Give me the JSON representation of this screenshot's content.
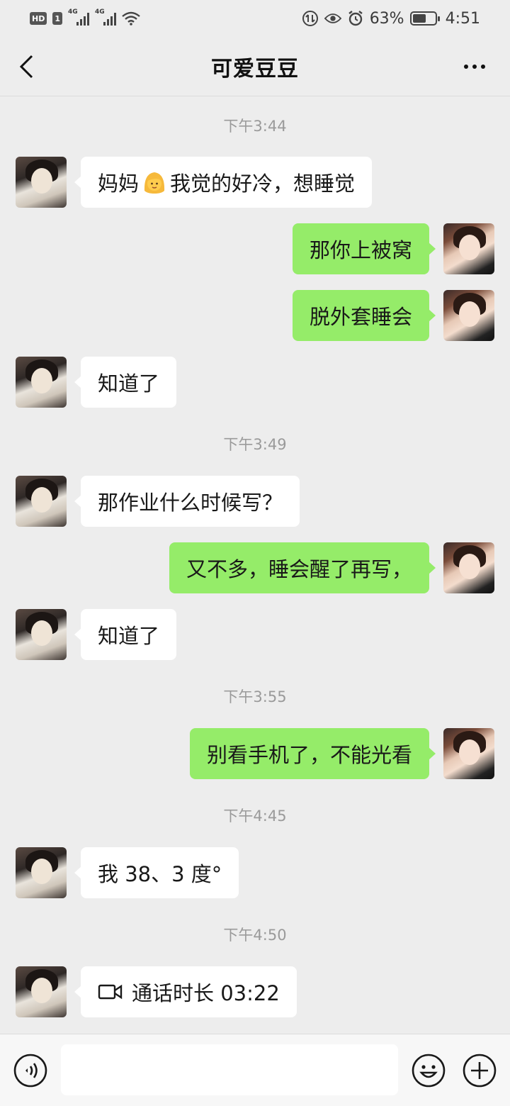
{
  "status_bar": {
    "left_badge_hd": "HD",
    "left_badge_sim": "1",
    "network_1": "4G",
    "network_2": "4G",
    "battery_percent": "63%",
    "battery_level": 0.63,
    "time": "4:51"
  },
  "header": {
    "title": "可爱豆豆"
  },
  "messages": [
    {
      "type": "time",
      "text": "下午3:44"
    },
    {
      "type": "in",
      "text_before": "妈妈",
      "emoji": "person-blond-hair-emoji",
      "text_after": "我觉的好冷，想睡觉"
    },
    {
      "type": "out",
      "text": "那你上被窝"
    },
    {
      "type": "out",
      "text": "脱外套睡会"
    },
    {
      "type": "in",
      "text": "知道了"
    },
    {
      "type": "time",
      "text": "下午3:49"
    },
    {
      "type": "in",
      "text": "那作业什么时候写？"
    },
    {
      "type": "out",
      "text": "又不多，睡会醒了再写，"
    },
    {
      "type": "in",
      "text": "知道了"
    },
    {
      "type": "time",
      "text": "下午3:55"
    },
    {
      "type": "out",
      "text": "别看手机了，不能光看"
    },
    {
      "type": "time",
      "text": "下午4:45"
    },
    {
      "type": "in",
      "text": "我 38、3 度°"
    },
    {
      "type": "time",
      "text": "下午4:50"
    },
    {
      "type": "in",
      "icon": "video-call-icon",
      "text": "通话时长 03:22"
    }
  ],
  "input_bar": {
    "placeholder": ""
  },
  "colors": {
    "background": "#ededed",
    "outgoing_bubble": "#95ec69",
    "incoming_bubble": "#ffffff",
    "time_text": "#9a9a9a"
  }
}
